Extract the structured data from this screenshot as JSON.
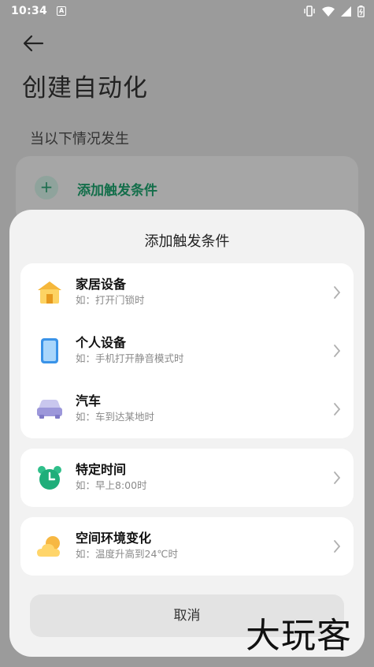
{
  "status_bar": {
    "time": "10:34",
    "app_badge": "A"
  },
  "page": {
    "title": "创建自动化",
    "section_label": "当以下情况发生"
  },
  "trigger_card": {
    "add_label": "添加触发条件"
  },
  "sheet": {
    "title": "添加触发条件",
    "groups": [
      [
        {
          "icon": "home-icon",
          "title": "家居设备",
          "subtitle": "如：打开门锁时"
        },
        {
          "icon": "phone-icon",
          "title": "个人设备",
          "subtitle": "如：手机打开静音模式时"
        },
        {
          "icon": "car-icon",
          "title": "汽车",
          "subtitle": "如：车到达某地时"
        }
      ],
      [
        {
          "icon": "alarm-clock-icon",
          "title": "特定时间",
          "subtitle": "如：早上8:00时"
        }
      ],
      [
        {
          "icon": "weather-icon",
          "title": "空间环境变化",
          "subtitle": "如：温度升高到24℃时"
        }
      ]
    ],
    "cancel_label": "取消"
  },
  "watermark": "大玩客",
  "colors": {
    "accent_green": "#136e4a",
    "sheet_bg": "#f2f2f2",
    "scrim": "#9b9b9b"
  }
}
